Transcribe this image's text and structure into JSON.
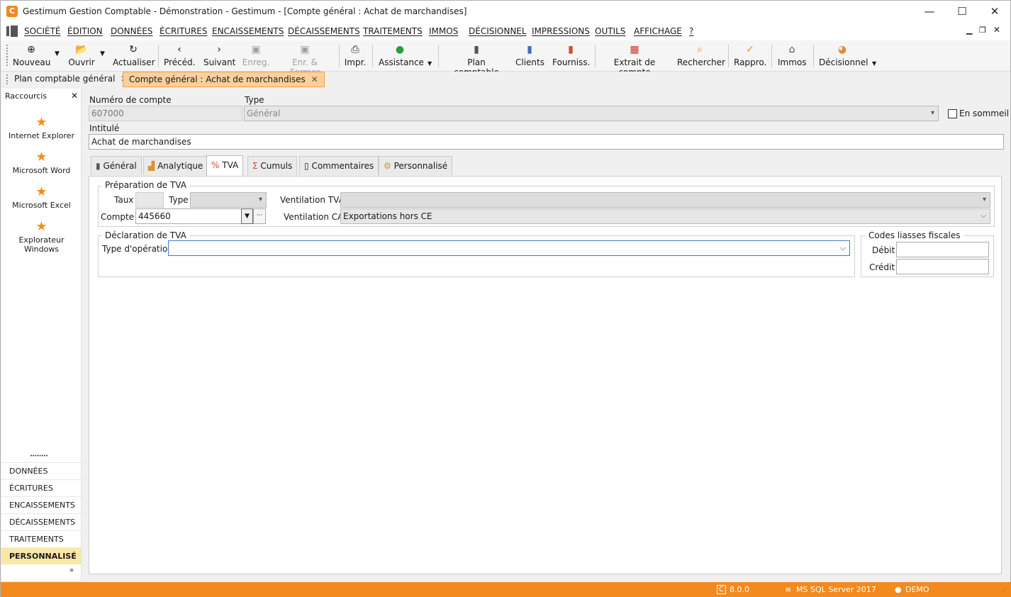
{
  "window": {
    "title": "Gestimum Gestion Comptable - Démonstration - Gestimum - [Compte général : Achat de marchandises]",
    "app_icon": "C"
  },
  "window_controls": {
    "minimize": "—",
    "maximize": "☐",
    "close": "✕"
  },
  "menu": [
    "SOCIÉTÉ",
    "ÉDITION",
    "DONNÉES",
    "ÉCRITURES",
    "ENCAISSEMENTS",
    "DÉCAISSEMENTS",
    "TRAITEMENTS",
    "IMMOS",
    "DÉCISIONNEL",
    "IMPRESSIONS",
    "OUTILS",
    "AFFICHAGE",
    "?"
  ],
  "toolbar": {
    "nouveau": "Nouveau",
    "ouvrir": "Ouvrir",
    "actualiser": "Actualiser",
    "preced": "Précéd.",
    "suivant": "Suivant",
    "enreg": "Enreg.",
    "enr_fermer": "Enr. & Fermer",
    "impr": "Impr.",
    "assistance": "Assistance",
    "plan": "Plan comptable",
    "clients": "Clients",
    "fourniss": "Fourniss.",
    "extrait": "Extrait de compte",
    "rechercher": "Rechercher",
    "rappro": "Rappro.",
    "immos": "Immos",
    "decisionnel": "Décisionnel"
  },
  "doc_tabs": [
    "Plan comptable général",
    "Compte général : Achat de marchandises"
  ],
  "sidebar": {
    "title": "Raccourcis",
    "shortcuts": [
      "Internet Explorer",
      "Microsoft Word",
      "Microsoft Excel",
      "Explorateur Windows"
    ],
    "categories": [
      "DONNÉES",
      "ÉCRITURES",
      "ENCAISSEMENTS",
      "DÉCAISSEMENTS",
      "TRAITEMENTS",
      "PERSONNALISÉ"
    ],
    "dots": "••••••••"
  },
  "form": {
    "numero_label": "Numéro de compte",
    "numero_value": "607000",
    "type_label": "Type",
    "type_value": "Général",
    "sommeil_label": "En sommeil",
    "intitule_label": "Intitulé",
    "intitule_value": "Achat de marchandises"
  },
  "form_tabs": [
    "Général",
    "Analytique",
    "TVA",
    "Cumuls",
    "Commentaires",
    "Personnalisé"
  ],
  "tva": {
    "prep_title": "Préparation de TVA",
    "taux_label": "Taux",
    "type_label": "Type",
    "compte_label": "Compte",
    "compte_value": "445660",
    "vent_tva_label": "Ventilation TVA",
    "vent_ca_label": "Ventilation CA",
    "vent_ca_value": "Exportations hors CE",
    "decl_title": "Déclaration de TVA",
    "type_op_label": "Type d'opération",
    "codes_title": "Codes liasses fiscales",
    "debit_label": "Débit",
    "credit_label": "Crédit"
  },
  "status": {
    "version": "8.0.0",
    "db": "MS SQL Server 2017",
    "user": "DEMO"
  }
}
